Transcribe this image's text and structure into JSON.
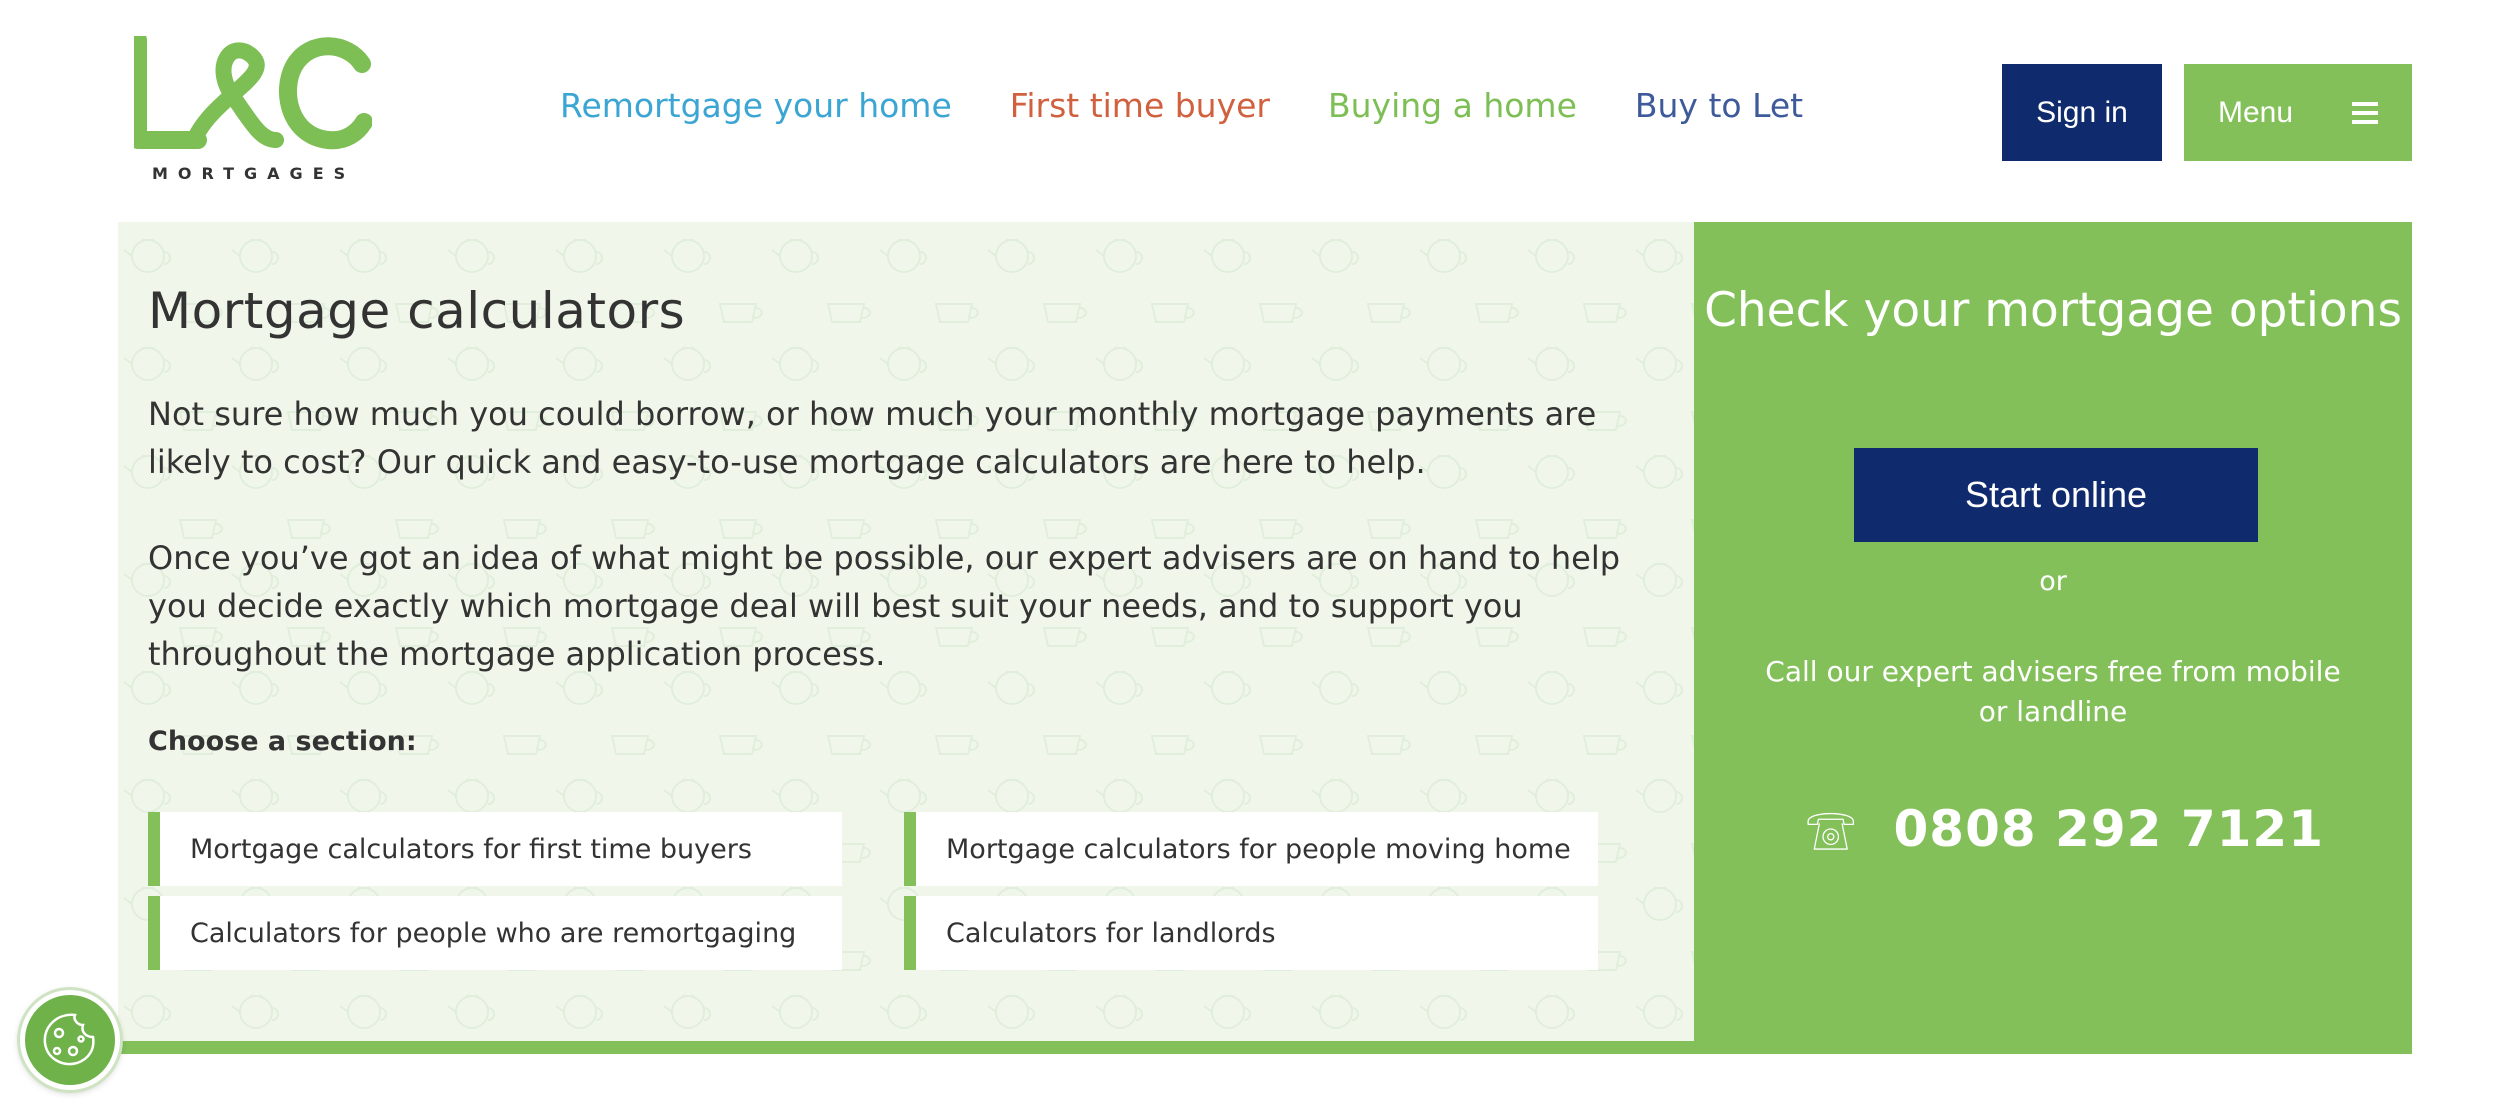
{
  "header": {
    "logo": {
      "mark": "L&C",
      "subtitle": "MORTGAGES"
    },
    "nav": [
      {
        "label": "Remortgage your home",
        "color": "#3ba5d3"
      },
      {
        "label": "First time buyer",
        "color": "#d0603e"
      },
      {
        "label": "Buying a home",
        "color": "#7dbe55"
      },
      {
        "label": "Buy to Let",
        "color": "#3e5a9a"
      }
    ],
    "signin_label": "Sign in",
    "menu_label": "Menu"
  },
  "main": {
    "title": "Mortgage calculators",
    "intro_1": "Not sure how much you could borrow, or how much your monthly mortgage payments are likely to cost? Our quick and easy-to-use mortgage calculators are here to help.",
    "intro_2": "Once you’ve got an idea of what might be possible, our expert advisers are on hand to help you decide exactly which mortgage deal will best suit your needs, and to support you throughout the mortgage application process.",
    "choose_label": "Choose a section:",
    "sections": [
      {
        "label": "Mortgage calculators for first time buyers"
      },
      {
        "label": "Mortgage calculators for people moving home"
      },
      {
        "label": "Calculators for people who are remortgaging"
      },
      {
        "label": "Calculators for landlords"
      }
    ]
  },
  "cta": {
    "title": "Check your mortgage options",
    "start_label": "Start online",
    "or_label": "or",
    "call_text": "Call our expert advisers free from mobile or landline",
    "phone": "0808 292 7121",
    "icon": "telephone-icon"
  },
  "cookie": {
    "icon": "cookie-icon"
  },
  "colors": {
    "brand_green": "#83c05a",
    "brand_navy": "#0f2b6e",
    "hero_bg": "#f0f7ea"
  }
}
